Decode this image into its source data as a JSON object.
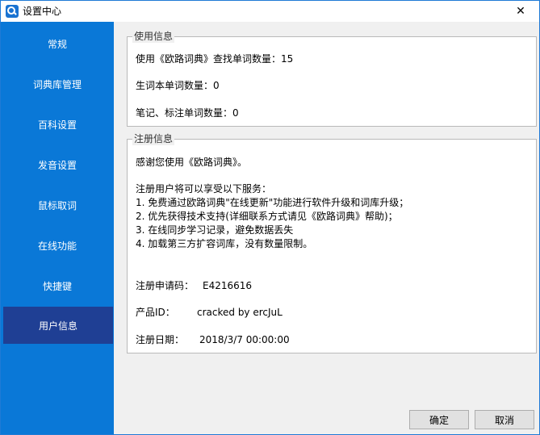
{
  "window": {
    "title": "设置中心",
    "close_glyph": "✕"
  },
  "sidebar": {
    "items": [
      {
        "label": "常规"
      },
      {
        "label": "词典库管理"
      },
      {
        "label": "百科设置"
      },
      {
        "label": "发音设置"
      },
      {
        "label": "鼠标取词"
      },
      {
        "label": "在线功能"
      },
      {
        "label": "快捷键"
      },
      {
        "label": "用户信息"
      }
    ],
    "active": "用户信息",
    "colors": {
      "background": "#0a78d7",
      "active": "#1f3f94"
    }
  },
  "usage": {
    "title": "使用信息",
    "lookups": "使用《欧路词典》查找单词数量：15",
    "vocab": "生词本单词数量：0",
    "notes": "笔记、标注单词数量：0"
  },
  "registration": {
    "title": "注册信息",
    "thanks": "感谢您使用《欧路词典》。",
    "benefits_intro": "注册用户将可以享受以下服务：",
    "benefits": [
      "1. 免费通过欧路词典\"在线更新\"功能进行软件升级和词库升级；",
      "2. 优先获得技术支持(详细联系方式请见《欧路词典》帮助)；",
      "3. 在线同步学习记录，避免数据丢失",
      "4. 加载第三方扩容词库，没有数量限制。"
    ],
    "request_code_label": "注册申请码：",
    "request_code_value": "E4216616",
    "product_id_label": "产品ID：",
    "product_id_value": "cracked by ercJuL",
    "date_label": "注册日期：",
    "date_value": "2018/3/7 00:00:00"
  },
  "buttons": {
    "ok": "确定",
    "cancel": "取消"
  }
}
